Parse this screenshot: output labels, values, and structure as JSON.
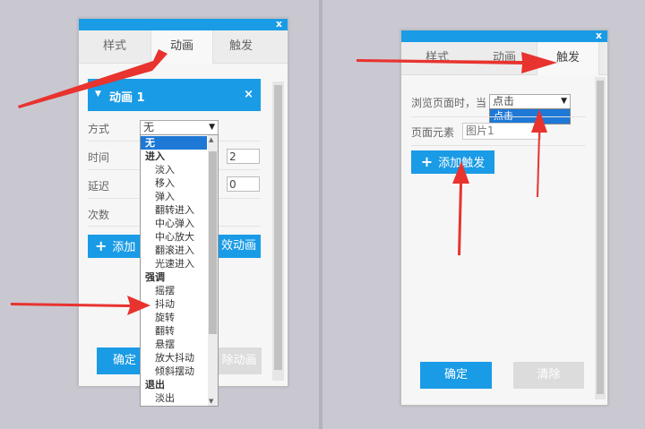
{
  "panel_left": {
    "close_label": "x",
    "tabs": [
      {
        "label": "样式",
        "active": false
      },
      {
        "label": "动画",
        "active": true
      },
      {
        "label": "触发",
        "active": false
      }
    ],
    "animation": {
      "name": "动画 1",
      "remove_label": "×",
      "mode_label": "方式",
      "mode_value": "无",
      "time_label": "时间",
      "time_value": "2",
      "delay_label": "延迟",
      "delay_value": "0",
      "count_label": "次数"
    },
    "add_animation_left": "添加",
    "add_animation_right": "效动画",
    "confirm_label": "确定",
    "clear_label": "除动画",
    "dropdown": [
      {
        "label": "无",
        "kind": "selected"
      },
      {
        "label": "进入",
        "kind": "group"
      },
      {
        "label": "淡入",
        "kind": "item"
      },
      {
        "label": "移入",
        "kind": "item"
      },
      {
        "label": "弹入",
        "kind": "item"
      },
      {
        "label": "翻转进入",
        "kind": "item"
      },
      {
        "label": "中心弹入",
        "kind": "item"
      },
      {
        "label": "中心放大",
        "kind": "item"
      },
      {
        "label": "翻滚进入",
        "kind": "item"
      },
      {
        "label": "光速进入",
        "kind": "item"
      },
      {
        "label": "强调",
        "kind": "group"
      },
      {
        "label": "摇摆",
        "kind": "item"
      },
      {
        "label": "抖动",
        "kind": "item"
      },
      {
        "label": "旋转",
        "kind": "item"
      },
      {
        "label": "翻转",
        "kind": "item"
      },
      {
        "label": "悬摆",
        "kind": "item"
      },
      {
        "label": "放大抖动",
        "kind": "item"
      },
      {
        "label": "倾斜摆动",
        "kind": "item"
      },
      {
        "label": "退出",
        "kind": "group"
      },
      {
        "label": "淡出",
        "kind": "item"
      }
    ]
  },
  "panel_right": {
    "close_label": "x",
    "tabs": [
      {
        "label": "样式",
        "active": false
      },
      {
        "label": "动画",
        "active": false
      },
      {
        "label": "触发",
        "active": true
      }
    ],
    "browse_label": "浏览页面时，当",
    "trigger_value": "点击",
    "trigger_option": "点击",
    "element_label": "页面元素",
    "element_value": "图片1",
    "add_trigger_label": "添加触发",
    "confirm_label": "确定",
    "clear_label": "清除"
  },
  "colors": {
    "accent": "#1a9be6",
    "arrow": "#e8332f",
    "selected": "#1e78d6"
  }
}
